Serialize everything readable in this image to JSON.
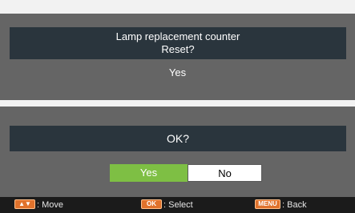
{
  "dialog": {
    "title_line1": "Lamp replacement counter",
    "title_line2": "Reset?",
    "value": "Yes",
    "confirm_text": "OK?",
    "yes_label": "Yes",
    "no_label": "No"
  },
  "footer": {
    "move": {
      "key": "▲▼",
      "label": ": Move"
    },
    "select": {
      "key": "OK",
      "label": ": Select"
    },
    "back": {
      "key": "MENU",
      "label": ": Back"
    }
  },
  "colors": {
    "panel": "#656565",
    "bar": "#2a353d",
    "selected": "#7ebf44",
    "key": "#e0722c",
    "footer": "#1b1b1b"
  }
}
